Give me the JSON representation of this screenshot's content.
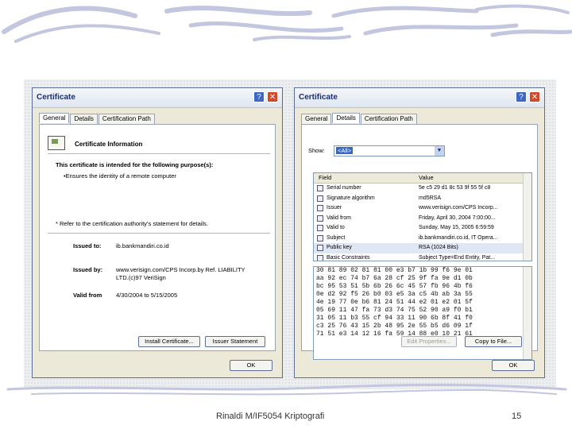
{
  "slide": {
    "footer_text": "Rinaldi M/IF5054 Kriptografi",
    "page_number": "15"
  },
  "left_dialog": {
    "title": "Certificate",
    "help_label": "?",
    "close_label": "✕",
    "tabs": [
      "General",
      "Details",
      "Certification Path"
    ],
    "info_title": "Certificate Information",
    "purpose_heading": "This certificate is intended for the following purpose(s):",
    "purpose_item": "•Ensures the identity of a remote computer",
    "refer_note": "* Refer to the certification authority's statement for details.",
    "issued_to_label": "Issued to:",
    "issued_to_value": "ib.bankmandiri.co.id",
    "issued_by_label": "Issued by:",
    "issued_by_value_1": "www.verisign.com/CPS Incorp.by Ref. LIABILITY",
    "issued_by_value_2": "LTD.(c)97 VeriSign",
    "valid_from_label": "Valid from",
    "valid_from_value": "4/30/2004 to 5/15/2005",
    "install_button": "Install Certificate...",
    "issuer_button": "Issuer Statement",
    "ok_button": "OK"
  },
  "right_dialog": {
    "title": "Certificate",
    "help_label": "?",
    "close_label": "✕",
    "tabs": [
      "General",
      "Details",
      "Certification Path"
    ],
    "show_label": "Show:",
    "show_value": "<All>",
    "columns": [
      "Field",
      "Value"
    ],
    "rows": [
      {
        "field": "Serial number",
        "value": "5e c5 29 d1 8c 53 9f 55 5f c8"
      },
      {
        "field": "Signature algorithm",
        "value": "md5RSA"
      },
      {
        "field": "Issuer",
        "value": "www.verisign.com/CPS Incorp..."
      },
      {
        "field": "Valid from",
        "value": "Friday, April 30, 2004 7:00:00..."
      },
      {
        "field": "Valid to",
        "value": "Sunday, May 15, 2005 6:59:59"
      },
      {
        "field": "Subject",
        "value": "ib.bankmandiri.co.id, IT Opera..."
      },
      {
        "field": "Public key",
        "value": "RSA (1024 Bits)"
      },
      {
        "field": "Basic Constraints",
        "value": "Subject Type=End Entity, Pat..."
      }
    ],
    "hex_lines": [
      "30 81 89 02 81 81 00 e3 b7 1b 99 f6 9e 01",
      "aa 92 ec 74 b7 6a 28 cf 25 9f fa 9e d1 0b",
      "bc 95 53 51 5b 6b 26 6c 45 57 fb 96 4b f6",
      "0e d2 92 f5 26 b0 03 e5 3a c5 4b ab 3a 55",
      "4e 19 77 0e b6 81 24 51 44 e2 01 e2 01 5f",
      "05 69 11 47 fa 73 d3 74 75 52 90 a9 f0 b1",
      "31 05 11 b3 55 cf 94 33 11 90 6b 8f 41 f0",
      "c3 25 76 43 15 2b 48 95 2e 55 b5 d6 09 1f",
      "71 51 e3 14 12 16 fa 59 14 88 e0 10 21 61"
    ],
    "edit_button": "Edit Properties...",
    "copy_button": "Copy to File...",
    "ok_button": "OK"
  }
}
